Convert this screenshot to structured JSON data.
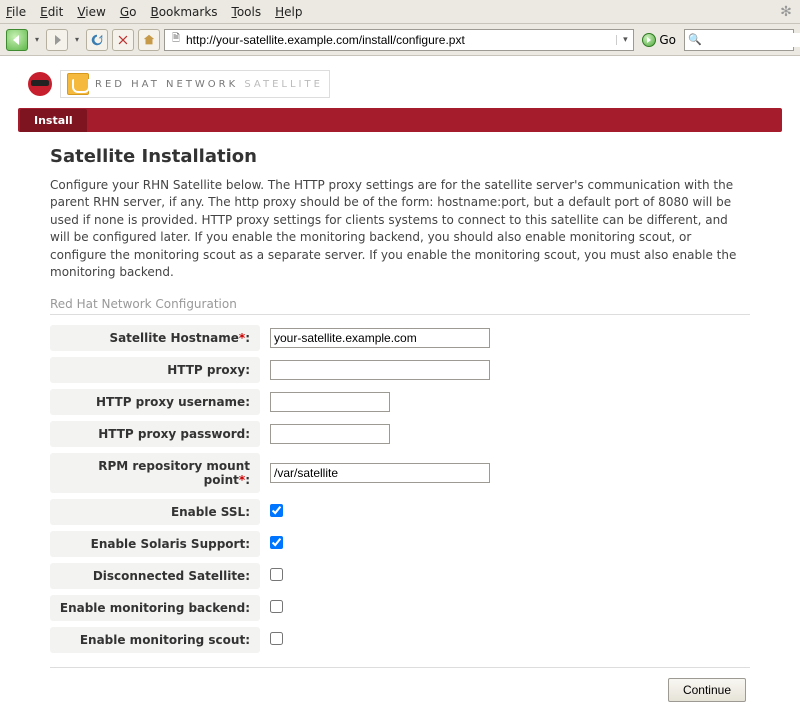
{
  "menu": {
    "file": "File",
    "edit": "Edit",
    "view": "View",
    "go": "Go",
    "bookmarks": "Bookmarks",
    "tools": "Tools",
    "help": "Help"
  },
  "toolbar": {
    "url": "http://your-satellite.example.com/install/configure.pxt",
    "go_label": "Go"
  },
  "brand": {
    "text_a": "RED HAT NETWORK",
    "text_b": "SATELLITE"
  },
  "tab": {
    "label": "Install"
  },
  "page": {
    "title": "Satellite Installation",
    "intro": "Configure your RHN Satellite below. The HTTP proxy settings are for the satellite server's communication with the parent RHN server, if any. The http proxy should be of the form: hostname:port, but a default port of 8080 will be used if none is provided. HTTP proxy settings for clients systems to connect to this satellite can be different, and will be configured later. If you enable the monitoring backend, you should also enable monitoring scout, or configure the monitoring scout as a separate server. If you enable the monitoring scout, you must also enable the monitoring backend.",
    "section": "Red Hat Network Configuration",
    "continue": "Continue"
  },
  "form": {
    "hostname_label": "Satellite Hostname",
    "hostname_value": "your-satellite.example.com",
    "proxy_label": "HTTP proxy:",
    "proxy_value": "",
    "proxy_user_label": "HTTP proxy username:",
    "proxy_user_value": "",
    "proxy_pass_label": "HTTP proxy password:",
    "proxy_pass_value": "",
    "mount_label": "RPM repository mount point",
    "mount_value": "/var/satellite",
    "ssl_label": "Enable SSL:",
    "ssl_checked": true,
    "solaris_label": "Enable Solaris Support:",
    "solaris_checked": true,
    "disconnected_label": "Disconnected Satellite:",
    "disconnected_checked": false,
    "mon_backend_label": "Enable monitoring backend:",
    "mon_backend_checked": false,
    "mon_scout_label": "Enable monitoring scout:",
    "mon_scout_checked": false
  }
}
